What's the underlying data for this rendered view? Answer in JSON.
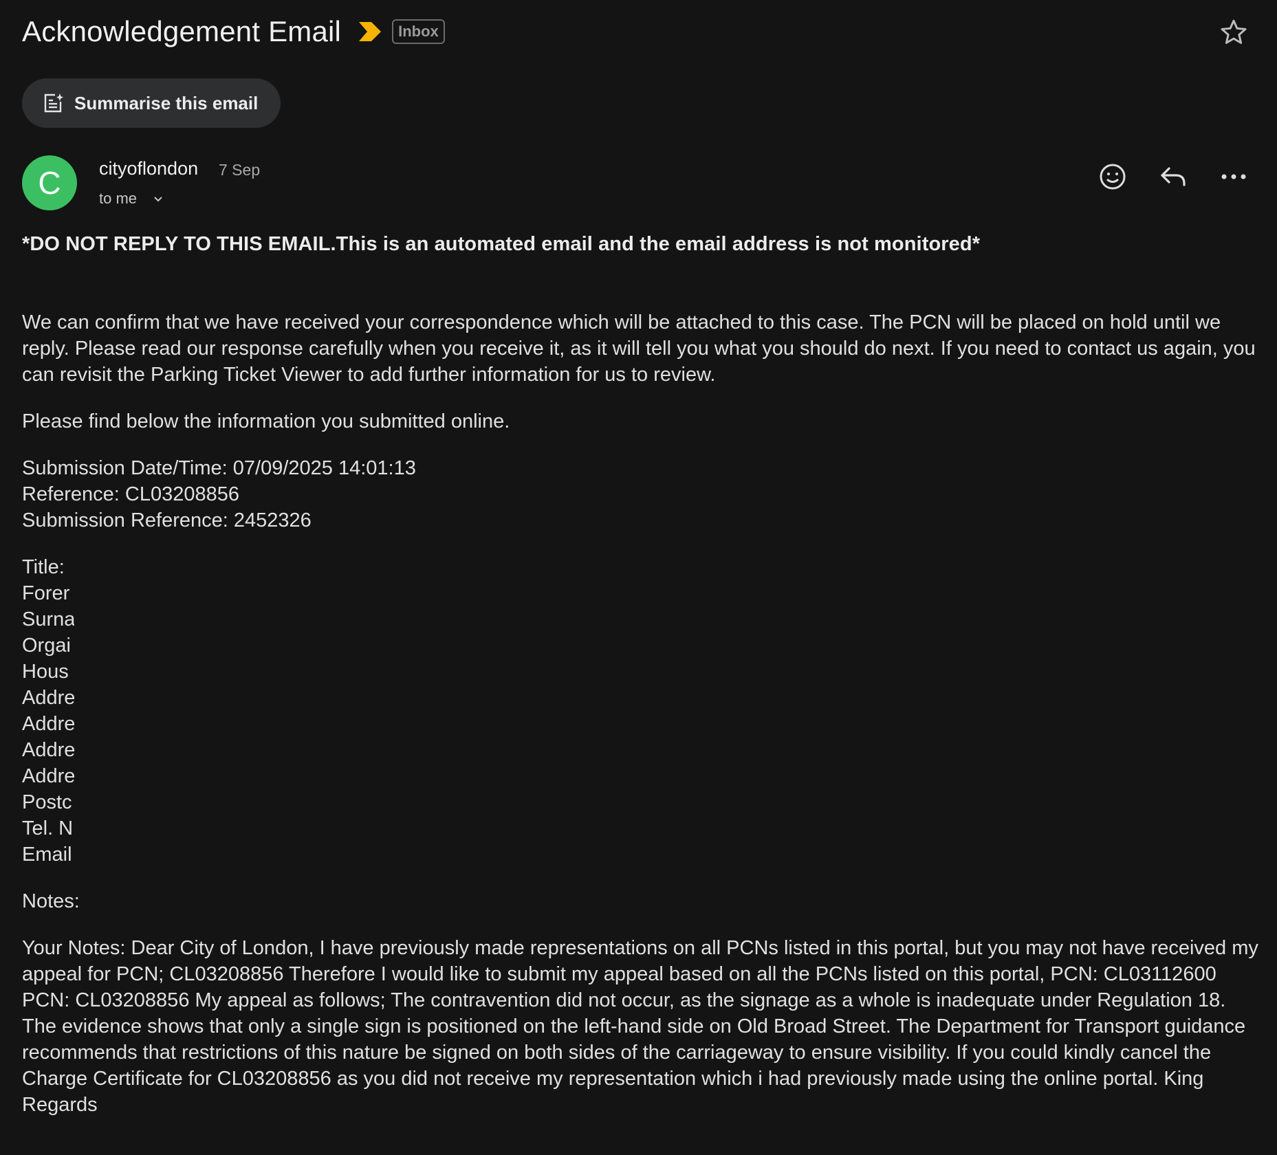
{
  "header": {
    "subject": "Acknowledgement Email",
    "label": "Inbox",
    "important_color": "#f6b400"
  },
  "summarise_button": {
    "label": "Summarise this email"
  },
  "sender": {
    "avatar_letter": "C",
    "avatar_color": "#3cbf62",
    "name": "cityoflondon",
    "date": "7 Sep",
    "recipients": "to me"
  },
  "message": {
    "warning": "*DO NOT REPLY TO THIS EMAIL.This is an automated email and the email address is not monitored*",
    "confirmation": "We can confirm that we have received your correspondence which will be attached to this case. The PCN will be placed on hold until we reply. Please read our response carefully when you receive it, as it will tell you what you should do next. If you need to contact us again, you can revisit the Parking Ticket Viewer to add further information for us to review.",
    "find_below": "Please find below the information you submitted online.",
    "submission_datetime": "Submission Date/Time: 07/09/2025 14:01:13",
    "reference": "Reference: CL03208856",
    "submission_reference": "Submission Reference: 2452326",
    "fields": [
      "Title:",
      "Forer",
      "Surna",
      "Orgai",
      "Hous",
      "Addre",
      "Addre",
      "Addre",
      "Addre",
      "Postc",
      "Tel. N",
      "Email"
    ],
    "notes_label": "Notes:",
    "your_notes": "Your Notes: Dear City of London, I have previously made representations on all PCNs listed in this portal, but you may not have received my appeal for PCN; CL03208856 Therefore I would like to submit my appeal based on all the PCNs listed on this portal, PCN: CL03112600 PCN: CL03208856 My appeal as follows; The contravention did not occur, as the signage as a whole is inadequate under Regulation 18. The evidence shows that only a single sign is positioned on the left-hand side on Old Broad Street. The Department for Transport guidance recommends that restrictions of this nature be signed on both sides of the carriageway to ensure visibility. If you could kindly cancel the Charge Certificate for CL03208856 as you did not receive my representation which i had previously made using the online portal. King Regards"
  }
}
